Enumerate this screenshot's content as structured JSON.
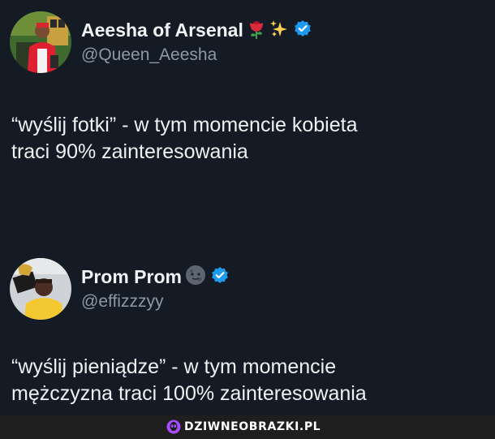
{
  "tweets": [
    {
      "author": {
        "display_name": "Aeesha of Arsenal",
        "handle": "@Queen_Aeesha",
        "emojis": [
          "rose-icon",
          "sparkles-icon"
        ],
        "verified": true
      },
      "text_lines": [
        "“wyślij fotki” - w tym momencie kobieta",
        "traci 90% zainteresowania"
      ]
    },
    {
      "author": {
        "display_name": "Prom Prom",
        "handle": "@effizzzyy",
        "emojis": [
          "new-moon-face-icon"
        ],
        "verified": true
      },
      "text_lines": [
        "“wyślij pieniądze” - w tym momencie",
        "mężczyzna traci 100% zainteresowania"
      ]
    }
  ],
  "watermark": {
    "text": "DZIWNEOBRAZKI.PL"
  },
  "colors": {
    "background": "#141b25",
    "text": "#e7e9ea",
    "handle": "#8b98a5",
    "verified": "#1d9bf0",
    "watermark_accent": "#a64dff"
  }
}
